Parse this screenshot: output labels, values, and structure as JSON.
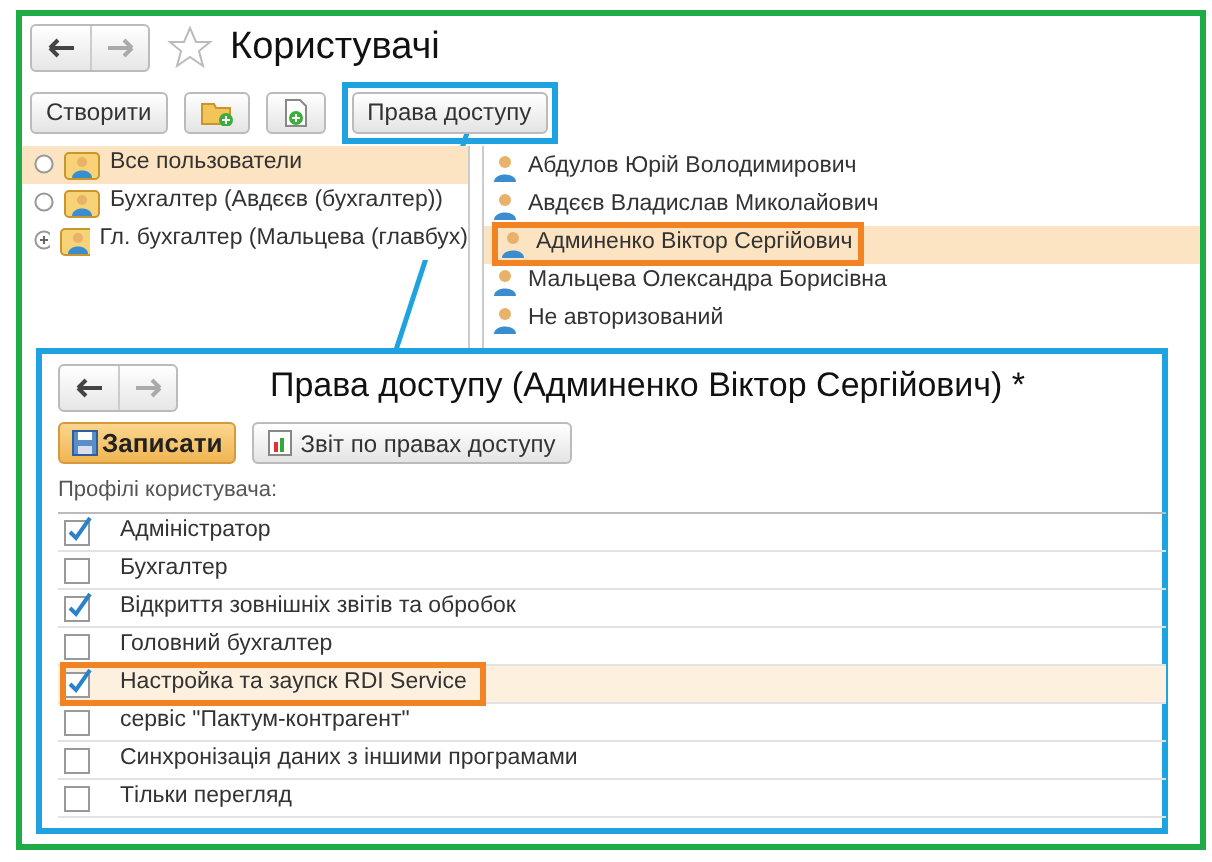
{
  "window": {
    "title": "Користувачі"
  },
  "toolbar": {
    "create_button": "Створити",
    "access_button": {
      "label": "Права доступу",
      "highlighted": true
    }
  },
  "groups": [
    {
      "kind": "radio",
      "label": "Все пользователи",
      "selected": true
    },
    {
      "kind": "radio",
      "label": "Бухгалтер (Авдєєв (бухгалтер))",
      "selected": false
    },
    {
      "kind": "expand",
      "label": "Гл. бухгалтер (Мальцева (главбух)",
      "selected": false
    }
  ],
  "users": [
    {
      "name": "Абдулов Юрій Володимирович",
      "selected": false,
      "highlighted": false
    },
    {
      "name": "Авдєєв Владислав Миколайович",
      "selected": false,
      "highlighted": false
    },
    {
      "name": "Админенко Віктор Сергійович",
      "selected": true,
      "highlighted": true
    },
    {
      "name": "Мальцева Олександра Борисівна",
      "selected": false,
      "highlighted": false
    },
    {
      "name": "Не авторизований",
      "selected": false,
      "highlighted": false
    }
  ],
  "dialog": {
    "title": "Права доступу (Админенко Віктор Сергійович) *",
    "save_button": "Записати",
    "report_button": "Звіт по правах доступу",
    "profiles_label": "Профілі користувача:",
    "profiles": [
      {
        "label": "Адміністратор",
        "checked": true,
        "selected": false,
        "highlighted": false
      },
      {
        "label": "Бухгалтер",
        "checked": false,
        "selected": false,
        "highlighted": false
      },
      {
        "label": "Відкриття зовнішніх звітів та обробок",
        "checked": true,
        "selected": false,
        "highlighted": false
      },
      {
        "label": "Головний бухгалтер",
        "checked": false,
        "selected": false,
        "highlighted": false
      },
      {
        "label": "Настройка та заупск RDI Service",
        "checked": true,
        "selected": true,
        "highlighted": true
      },
      {
        "label": "сервіс \"Пактум-контрагент\"",
        "checked": false,
        "selected": false,
        "highlighted": false
      },
      {
        "label": "Синхронізація даних з іншими програмами",
        "checked": false,
        "selected": false,
        "highlighted": false
      },
      {
        "label": "Тільки перегляд",
        "checked": false,
        "selected": false,
        "highlighted": false
      }
    ]
  }
}
